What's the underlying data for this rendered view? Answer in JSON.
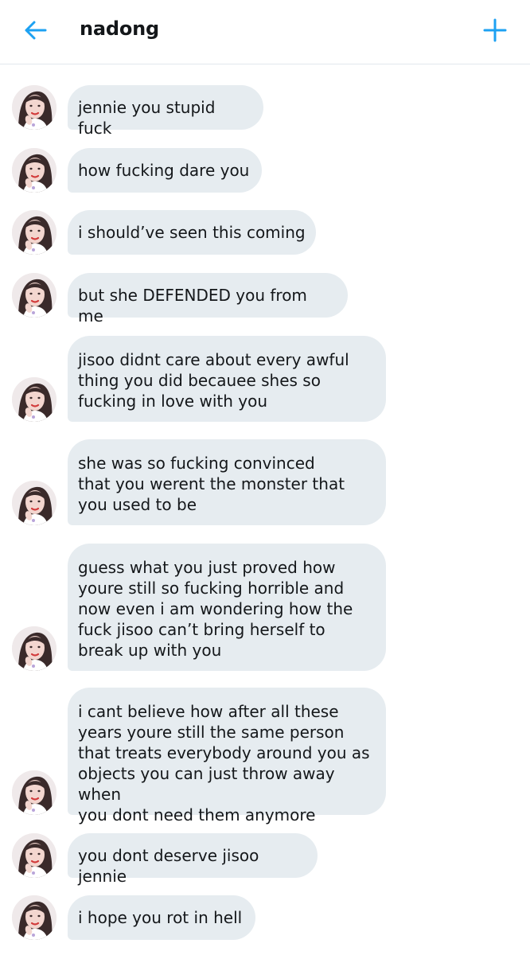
{
  "header": {
    "title": "nadong",
    "back_icon": "arrow-left-icon",
    "add_icon": "plus-icon",
    "accent_color": "#1da1f2"
  },
  "colors": {
    "bubble": "#e6ecf0",
    "text": "#14171a",
    "divider": "#e1e8ed"
  },
  "messages": [
    {
      "text": "jennie you stupid fuck"
    },
    {
      "text": "how fucking dare you"
    },
    {
      "text": "i should’ve seen this coming"
    },
    {
      "text": "but she DEFENDED you from me"
    },
    {
      "text": "jisoo didnt care about every awful\nthing you did becauee shes so\nfucking in love with you"
    },
    {
      "text": "she was so fucking convinced\nthat you werent the monster that\nyou used to be"
    },
    {
      "text": "guess what you just proved how\nyoure still so fucking horrible and\nnow even i am wondering how the\nfuck jisoo can’t bring herself to\nbreak up with you"
    },
    {
      "text": "i cant believe how after all these\nyears youre still the same person\nthat treats everybody around you as\nobjects you can just throw away when\nyou dont need them anymore"
    },
    {
      "text": "you dont deserve jisoo jennie"
    },
    {
      "text": "i hope you rot in hell"
    }
  ]
}
